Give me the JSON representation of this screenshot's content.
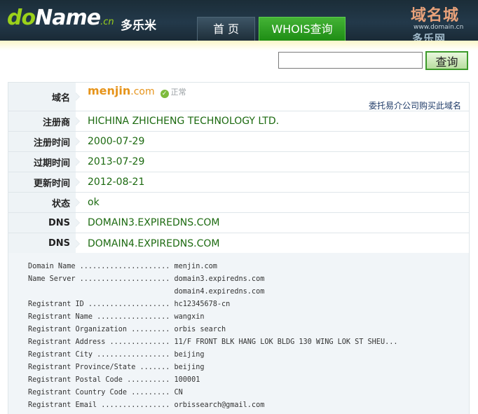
{
  "header": {
    "logo_main_a": "do",
    "logo_main_b": "Name",
    "logo_suffix": ".cn",
    "logo_cn": "多乐米",
    "nav_home": "首 页",
    "nav_whois": "WHOIS查询",
    "watermark_top": "域名城",
    "watermark_url": "www.domain.cn",
    "watermark_bottom": "多乐网"
  },
  "search": {
    "value": "",
    "button_label": "查询"
  },
  "info": {
    "domain_label": "域名",
    "domain_name": "menjin",
    "domain_tld": ".com",
    "status_icon_glyph": "✓",
    "status_text": "正常",
    "buy_link": "委托易介公司购买此域名",
    "rows": [
      {
        "label": "注册商",
        "value": "HICHINA ZHICHENG TECHNOLOGY LTD."
      },
      {
        "label": "注册时间",
        "value": "2000-07-29"
      },
      {
        "label": "过期时间",
        "value": "2013-07-29"
      },
      {
        "label": "更新时间",
        "value": "2012-08-21"
      },
      {
        "label": "状态",
        "value": "ok"
      },
      {
        "label": "DNS",
        "value": "DOMAIN3.EXPIREDNS.COM"
      },
      {
        "label": "DNS",
        "value": "DOMAIN4.EXPIREDNS.COM"
      }
    ]
  },
  "raw_whois": "Domain Name ..................... menjin.com\nName Server ..................... domain3.expiredns.com\n                                  domain4.expiredns.com\nRegistrant ID ................... hc12345678-cn\nRegistrant Name ................. wangxin\nRegistrant Organization ......... orbis search\nRegistrant Address .............. 11/F FRONT BLK HANG LOK BLDG 130 WING LOK ST SHEU...\nRegistrant City ................. beijing\nRegistrant Province/State ....... beijing\nRegistrant Postal Code .......... 100001\nRegistrant Country Code ......... CN\nRegistrant Email ................ orbissearch@gmail.com",
  "colors": {
    "accent_green": "#1e8d14",
    "domain_orange": "#e6941b",
    "header_dark": "#1b2d38"
  }
}
